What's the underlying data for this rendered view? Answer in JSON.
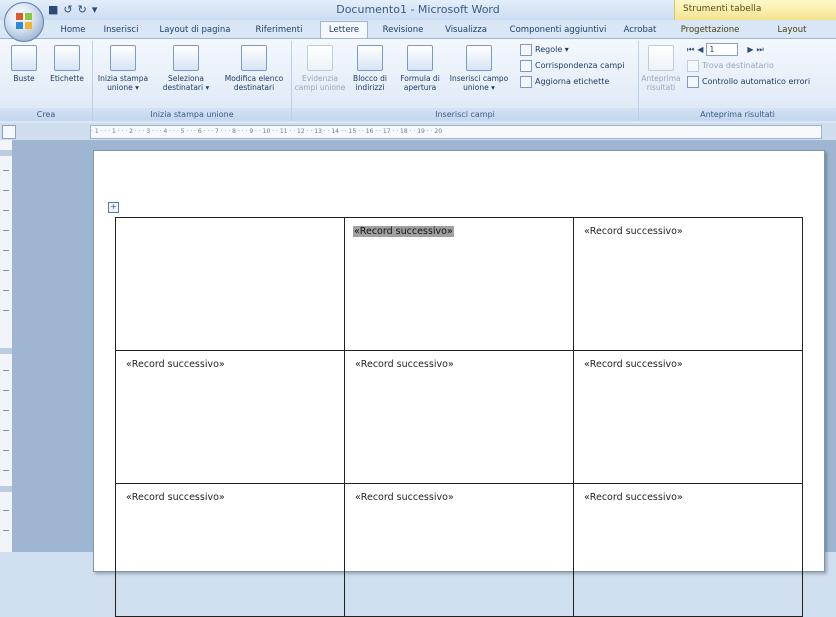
{
  "window": {
    "title": "Documento1 - Microsoft Word",
    "qat": {
      "save": "■",
      "undo": "↺",
      "redo": "↻",
      "customize": "▾"
    },
    "context_title": "Strumenti tabella"
  },
  "tabs": [
    {
      "label": "Home"
    },
    {
      "label": "Inserisci"
    },
    {
      "label": "Layout di pagina"
    },
    {
      "label": "Riferimenti"
    },
    {
      "label": "Lettere"
    },
    {
      "label": "Revisione"
    },
    {
      "label": "Visualizza"
    },
    {
      "label": "Componenti aggiuntivi"
    },
    {
      "label": "Acrobat"
    },
    {
      "label": "Progettazione"
    },
    {
      "label": "Layout"
    }
  ],
  "ribbon": {
    "crea": {
      "label": "Crea",
      "buste": "Buste",
      "etichette": "Etichette"
    },
    "inizia": {
      "label": "Inizia stampa unione",
      "inizia_btn": "Inizia stampa unione ▾",
      "seleziona_btn": "Seleziona destinatari ▾",
      "modifica_btn": "Modifica elenco destinatari"
    },
    "inserisci": {
      "label": "Inserisci campi",
      "evidenzia": "Evidenzia campi unione",
      "blocco": "Blocco di indirizzi",
      "formula": "Formula di apertura",
      "inserisci_campo": "Inserisci campo unione ▾",
      "regole": "Regole ▾",
      "corrispondenza": "Corrispondenza campi",
      "aggiorna": "Aggiorna etichette"
    },
    "anteprima": {
      "label": "Anteprima risultati",
      "anteprima_btn": "Anteprima risultati",
      "record_value": "1",
      "trova": "Trova destinatario",
      "controllo": "Controllo automatico errori"
    }
  },
  "ruler": {
    "text": "· 1 · · · 1 · · · 2 · · · 3 · · · 4 · · · 5 · · · 6 · · · 7 · · · 8 · · · 9 · · 10 · · 11 · · 12 · · 13 · · 14 · · 15 · · 16 · · 17 · · 18 · · 19 · · 20"
  },
  "table": {
    "rows": [
      [
        "",
        "«Record successivo»",
        "«Record successivo»"
      ],
      [
        "«Record successivo»",
        "«Record successivo»",
        "«Record successivo»"
      ],
      [
        "«Record successivo»",
        "«Record successivo»",
        "«Record successivo»"
      ]
    ]
  }
}
